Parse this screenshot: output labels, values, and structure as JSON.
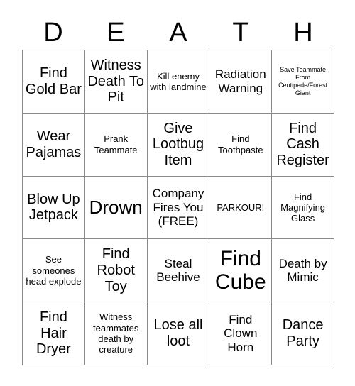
{
  "card": {
    "title_letters": [
      "D",
      "E",
      "A",
      "T",
      "H"
    ],
    "columns": 5,
    "rows": 5,
    "border_color": "#8a8a8a",
    "background_color": "#ffffff",
    "text_color": "#000000"
  },
  "cells": [
    {
      "text": "Find Gold Bar",
      "size": "l",
      "free": false
    },
    {
      "text": "Witness Death To Pit",
      "size": "l",
      "free": false
    },
    {
      "text": "Kill enemy with landmine",
      "size": "s",
      "free": false
    },
    {
      "text": "Radiation Warning",
      "size": "m",
      "free": false
    },
    {
      "text": "Save Teammate From Centipede/Forest Giant",
      "size": "xs",
      "free": false
    },
    {
      "text": "Wear Pajamas",
      "size": "l",
      "free": false
    },
    {
      "text": "Prank Teammate",
      "size": "s",
      "free": false
    },
    {
      "text": "Give Lootbug Item",
      "size": "l",
      "free": false
    },
    {
      "text": "Find Toothpaste",
      "size": "s",
      "free": false
    },
    {
      "text": "Find Cash Register",
      "size": "l",
      "free": false
    },
    {
      "text": "Blow Up Jetpack",
      "size": "l",
      "free": false
    },
    {
      "text": "Drown",
      "size": "xl",
      "free": false
    },
    {
      "text": "Company Fires You (FREE)",
      "size": "m",
      "free": true
    },
    {
      "text": "PARKOUR!",
      "size": "s",
      "free": false
    },
    {
      "text": "Find Magnifying Glass",
      "size": "s",
      "free": false
    },
    {
      "text": "See someones head explode",
      "size": "s",
      "free": false
    },
    {
      "text": "Find Robot Toy",
      "size": "l",
      "free": false
    },
    {
      "text": "Steal Beehive",
      "size": "m",
      "free": false
    },
    {
      "text": "Find Cube",
      "size": "xxl",
      "free": false
    },
    {
      "text": "Death by Mimic",
      "size": "m",
      "free": false
    },
    {
      "text": "Find Hair Dryer",
      "size": "l",
      "free": false
    },
    {
      "text": "Witness teammates death by creature",
      "size": "s",
      "free": false
    },
    {
      "text": "Lose all loot",
      "size": "l",
      "free": false
    },
    {
      "text": "Find Clown Horn",
      "size": "m",
      "free": false
    },
    {
      "text": "Dance Party",
      "size": "l",
      "free": false
    }
  ]
}
